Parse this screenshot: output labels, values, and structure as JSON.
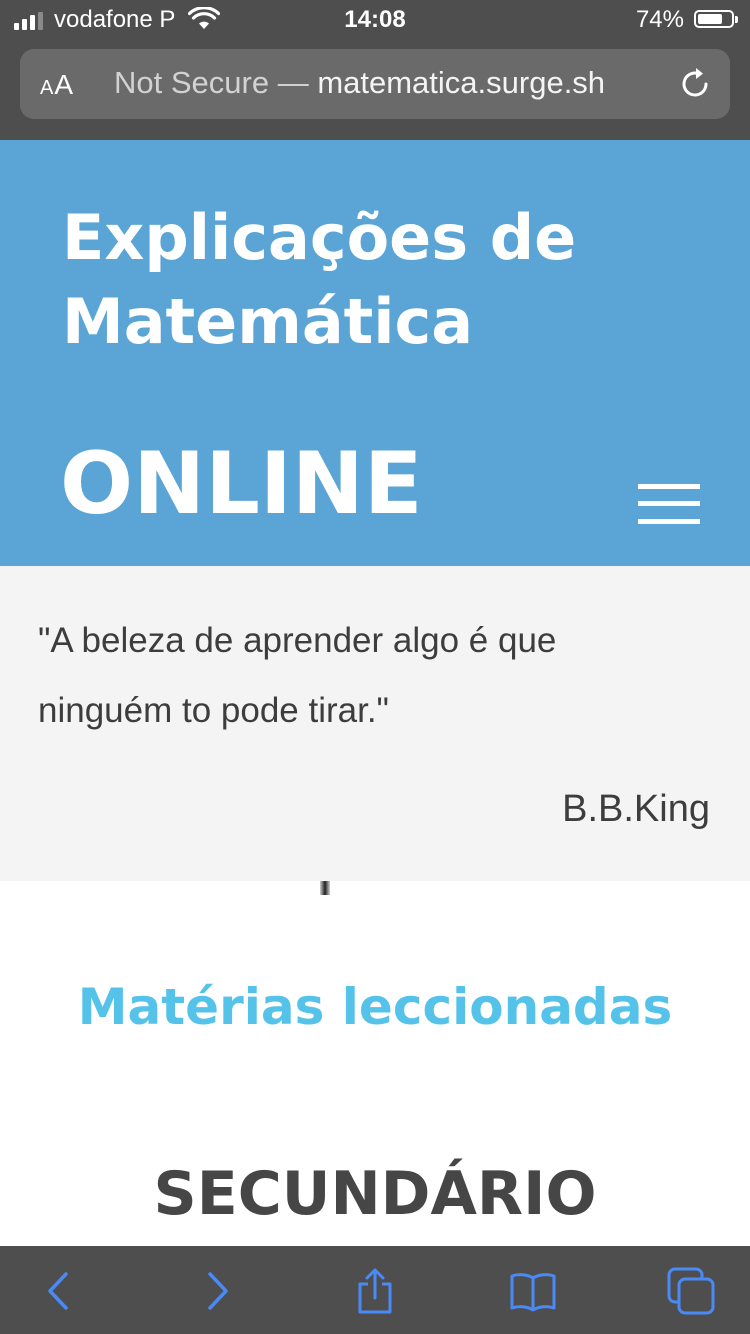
{
  "status": {
    "carrier": "vodafone P",
    "time": "14:08",
    "battery_percent": "74%",
    "battery_level": 0.74,
    "signal_bars": 3
  },
  "browser": {
    "text_size_label": "AA",
    "security_label": "Not Secure — ",
    "domain": "matematica.surge.sh",
    "reload_icon": "reload-icon"
  },
  "header": {
    "title": "Explicações de Matemática",
    "subtitle": "ONLINE",
    "menu_icon": "hamburger-menu-icon"
  },
  "quote": {
    "text": "\"A beleza de aprender algo é que ninguém to pode tirar.\"",
    "author": "B.B.King"
  },
  "content": {
    "section_title": "Matérias leccionadas",
    "level_heading": "SECUNDÁRIO"
  },
  "toolbar": {
    "icons": [
      "back-icon",
      "forward-icon",
      "share-icon",
      "bookmarks-icon",
      "tabs-icon"
    ]
  },
  "colors": {
    "header_bg": "#5aa4d6",
    "quote_bg": "#f4f4f4",
    "section_title": "#55c2ea",
    "level_heading": "#464646",
    "browser_chrome": "#4e4e4e",
    "toolbar_icon": "#4a8af6"
  }
}
